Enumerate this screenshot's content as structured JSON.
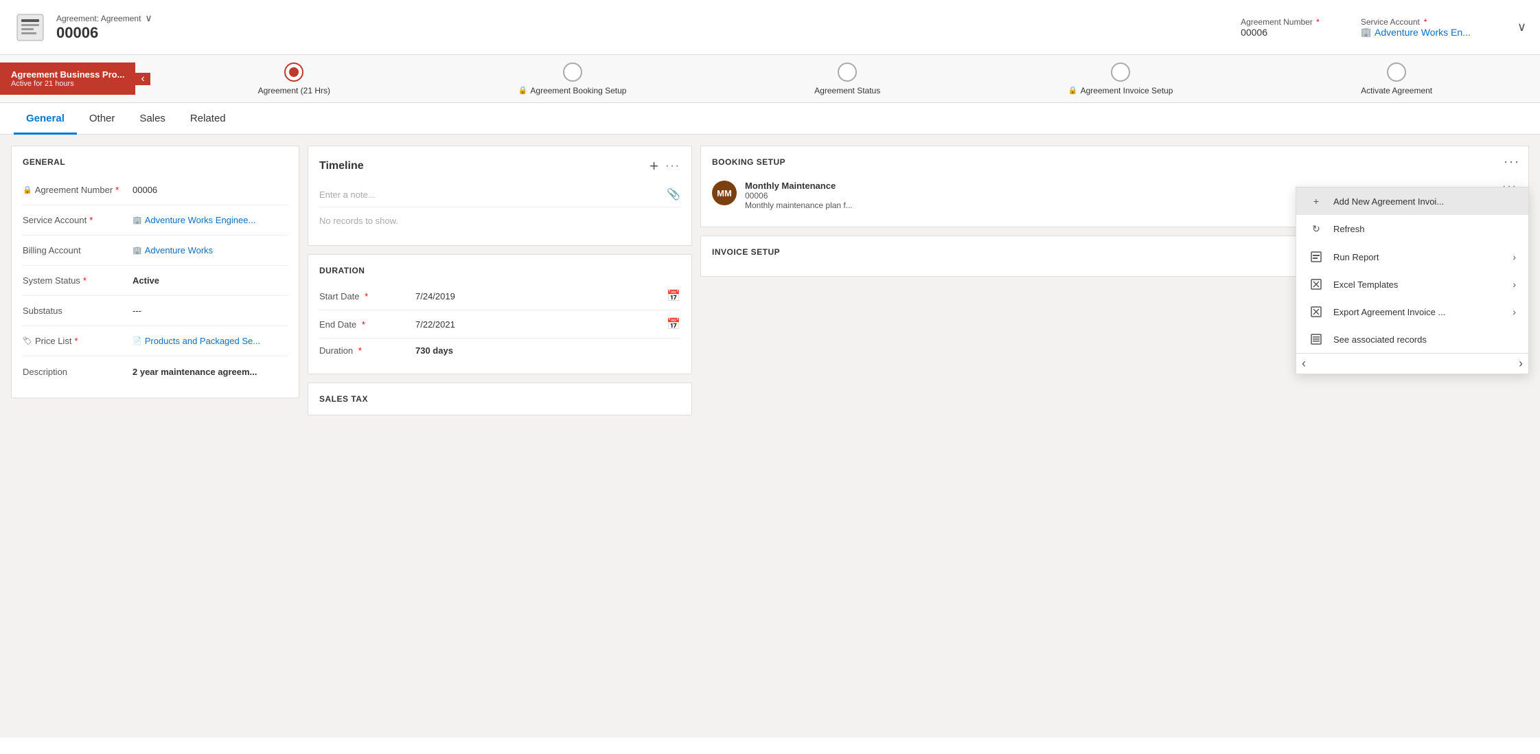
{
  "header": {
    "record_type": "Agreement: Agreement",
    "record_id": "00006",
    "agreement_number_label": "Agreement Number",
    "agreement_number_value": "00006",
    "service_account_label": "Service Account",
    "service_account_value": "Adventure Works En...",
    "chevron": "∨"
  },
  "stage_bar": {
    "active_label": "Agreement Business Pro...",
    "active_sub": "Active for 21 hours",
    "stages": [
      {
        "label": "Agreement (21 Hrs)",
        "locked": false,
        "active": true
      },
      {
        "label": "Agreement Booking Setup",
        "locked": true,
        "active": false
      },
      {
        "label": "Agreement Status",
        "locked": false,
        "active": false
      },
      {
        "label": "Agreement Invoice Setup",
        "locked": true,
        "active": false
      },
      {
        "label": "Activate Agreement",
        "locked": false,
        "active": false
      }
    ]
  },
  "tabs": [
    {
      "id": "general",
      "label": "General",
      "active": true
    },
    {
      "id": "other",
      "label": "Other",
      "active": false
    },
    {
      "id": "sales",
      "label": "Sales",
      "active": false
    },
    {
      "id": "related",
      "label": "Related",
      "active": false
    }
  ],
  "general_section": {
    "title": "GENERAL",
    "fields": [
      {
        "label": "Agreement Number",
        "value": "00006",
        "link": false,
        "required": true,
        "locked": true
      },
      {
        "label": "Service Account",
        "value": "Adventure Works Enginee...",
        "link": true,
        "required": true,
        "locked": false
      },
      {
        "label": "Billing Account",
        "value": "Adventure Works",
        "link": true,
        "required": false,
        "locked": false
      },
      {
        "label": "System Status",
        "value": "Active",
        "link": false,
        "required": true,
        "bold": true,
        "locked": false
      },
      {
        "label": "Substatus",
        "value": "---",
        "link": false,
        "required": false,
        "locked": false
      },
      {
        "label": "Price List",
        "value": "Products and Packaged Se...",
        "link": true,
        "required": true,
        "locked": true
      },
      {
        "label": "Description",
        "value": "2 year maintenance agreem...",
        "link": false,
        "required": false,
        "bold": true,
        "locked": false
      }
    ]
  },
  "timeline": {
    "title": "Timeline",
    "placeholder": "Enter a note...",
    "empty_text": "No records to show.",
    "add_btn_label": "+",
    "more_btn_label": "···"
  },
  "duration": {
    "title": "DURATION",
    "fields": [
      {
        "label": "Start Date",
        "value": "7/24/2019",
        "required": true
      },
      {
        "label": "End Date",
        "value": "7/22/2021",
        "required": true
      },
      {
        "label": "Duration",
        "value": "730 days",
        "required": true,
        "bold": true
      }
    ]
  },
  "sales_tax": {
    "title": "SALES TAX"
  },
  "booking_setup": {
    "title": "BOOKING SETUP",
    "items": [
      {
        "avatar_initials": "MM",
        "avatar_color": "#7b3f10",
        "name": "Monthly Maintenance",
        "id": "00006",
        "description": "Monthly maintenance plan f..."
      }
    ]
  },
  "invoice_setup": {
    "title": "INVOICE SETUP"
  },
  "context_menu": {
    "items": [
      {
        "label": "Add New Agreement Invoi...",
        "icon": "+",
        "arrow": false,
        "highlighted": true
      },
      {
        "label": "Refresh",
        "icon": "↻",
        "arrow": false,
        "highlighted": false
      },
      {
        "label": "Run Report",
        "icon": "▦",
        "arrow": true,
        "highlighted": false
      },
      {
        "label": "Excel Templates",
        "icon": "▣",
        "arrow": true,
        "highlighted": false
      },
      {
        "label": "Export Agreement Invoice ...",
        "icon": "▣",
        "arrow": true,
        "highlighted": false
      },
      {
        "label": "See associated records",
        "icon": "▤",
        "arrow": false,
        "highlighted": false
      }
    ]
  },
  "icons": {
    "lock": "🔒",
    "calendar": "📅",
    "paperclip": "📎",
    "tag": "🏷",
    "doc": "📄"
  }
}
